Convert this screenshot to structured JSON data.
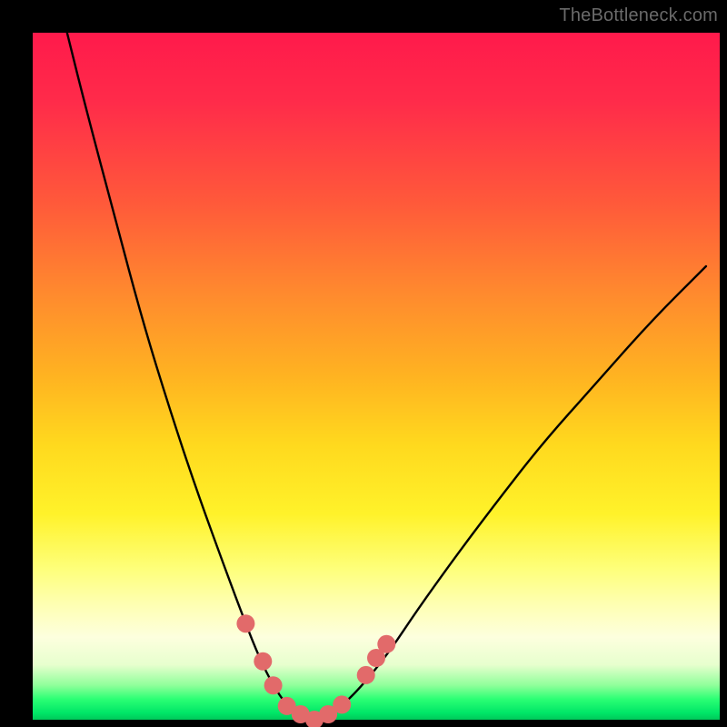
{
  "watermark": "TheBottleneck.com",
  "chart_data": {
    "type": "line",
    "title": "",
    "xlabel": "",
    "ylabel": "",
    "xlim": [
      0,
      100
    ],
    "ylim": [
      0,
      100
    ],
    "background_gradient": {
      "top": "#ff1a4b",
      "mid_upper": "#ff8a2e",
      "mid": "#ffd91e",
      "mid_lower": "#feff7a",
      "bottom": "#00c95a"
    },
    "series": [
      {
        "name": "bottleneck-curve",
        "color": "#000000",
        "x": [
          5,
          8,
          12,
          16,
          20,
          24,
          28,
          31,
          33,
          35,
          37,
          39,
          41,
          43,
          45,
          48,
          52,
          56,
          61,
          67,
          74,
          82,
          90,
          98
        ],
        "y": [
          100,
          88,
          73,
          58,
          45,
          33,
          22,
          14,
          9,
          5,
          2,
          0.5,
          0,
          0.5,
          2,
          5,
          10,
          16,
          23,
          31,
          40,
          49,
          58,
          66
        ]
      }
    ],
    "markers": {
      "name": "highlight-dots",
      "color": "#e26a6a",
      "radius_px": 10,
      "points_xy": [
        [
          31,
          14
        ],
        [
          33.5,
          8.5
        ],
        [
          35,
          5
        ],
        [
          37,
          2
        ],
        [
          39,
          0.8
        ],
        [
          41,
          0
        ],
        [
          43,
          0.8
        ],
        [
          45,
          2.2
        ],
        [
          48.5,
          6.5
        ],
        [
          50,
          9
        ],
        [
          51.5,
          11
        ]
      ]
    }
  }
}
